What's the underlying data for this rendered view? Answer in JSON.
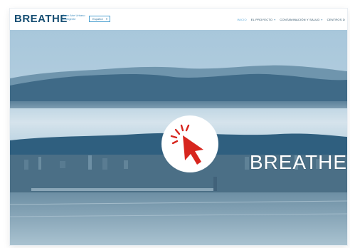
{
  "header": {
    "logo_text": "BREATHE",
    "tagline": "Buen Aire Urbano Inteligente",
    "language": {
      "selected": "Español"
    }
  },
  "nav": {
    "items": [
      {
        "label": "INICIO",
        "active": true,
        "dropdown": false
      },
      {
        "label": "EL PROYECTO",
        "active": false,
        "dropdown": true
      },
      {
        "label": "CONTAMINACIÓN Y SALUD",
        "active": false,
        "dropdown": true
      },
      {
        "label": "CENTROS D",
        "active": false,
        "dropdown": false
      }
    ]
  },
  "hero": {
    "brand_text": "BREATHE",
    "overlay_icon": "click-cursor-icon"
  },
  "colors": {
    "brand_blue": "#174f73",
    "accent_blue": "#5aa8d8",
    "cursor_red": "#d7261e"
  }
}
